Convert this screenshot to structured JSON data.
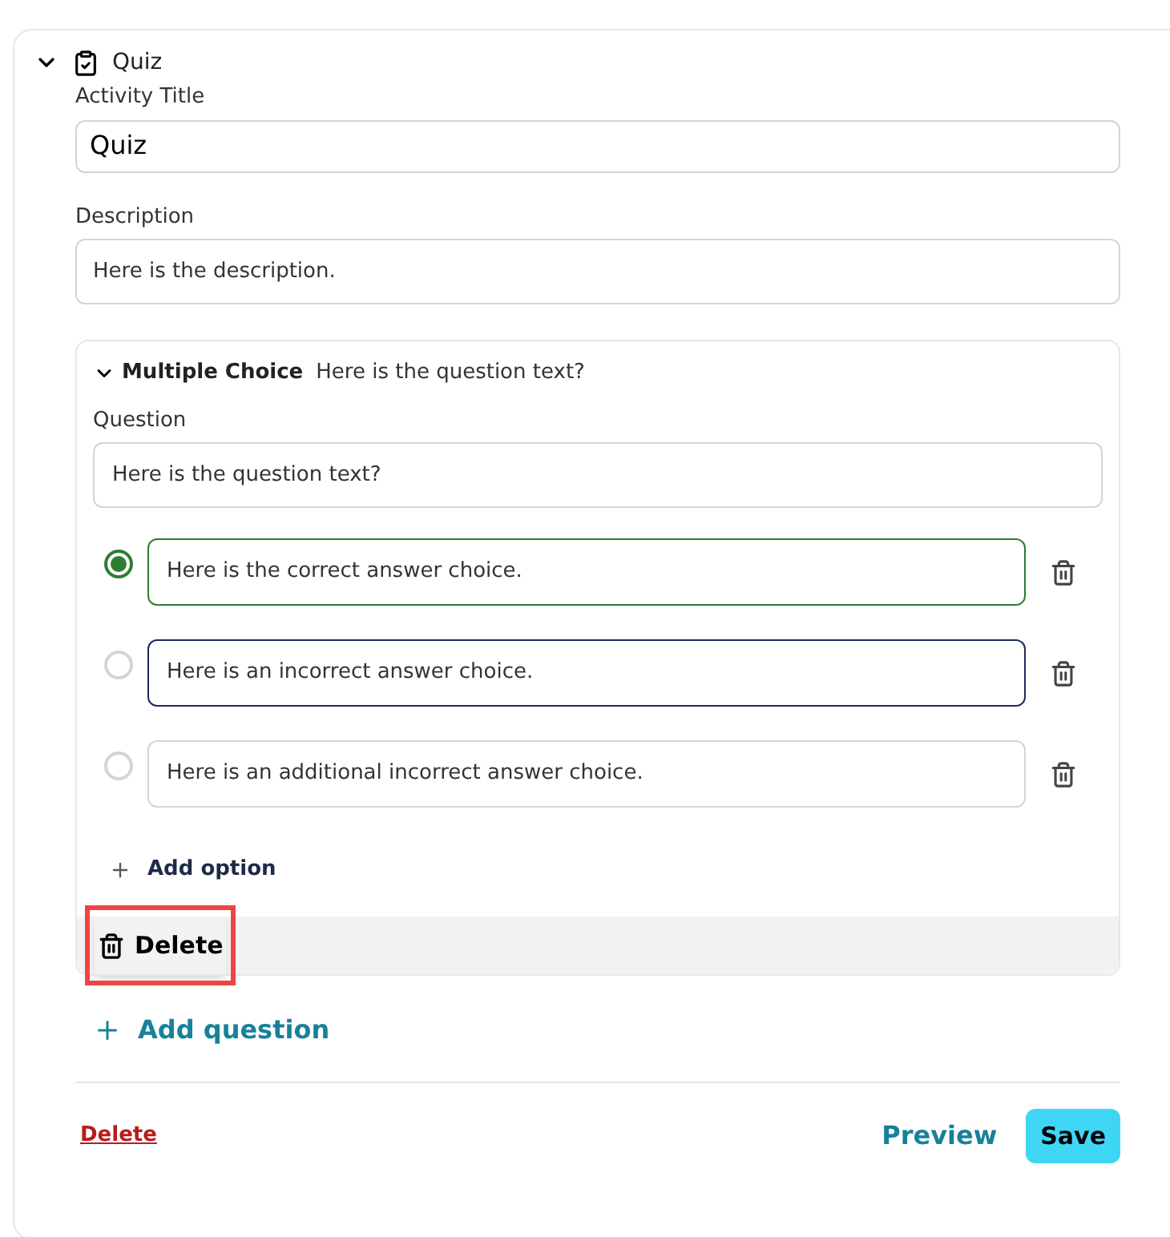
{
  "activity": {
    "title": "Quiz",
    "expanded": true
  },
  "fields": [
    {
      "label": "Activity Title",
      "value": "Quiz"
    },
    {
      "label": "Description",
      "value": "Here is the description."
    }
  ],
  "question": {
    "type_label": "Multiple Choice",
    "summary": "Here is the question text?",
    "expanded": true,
    "question_label": "Question",
    "question_value": "Here is the question text?",
    "choices": [
      {
        "text": "Here is the correct answer choice.",
        "selected": true,
        "focused": false
      },
      {
        "text": "Here is an incorrect answer choice.",
        "selected": false,
        "focused": true
      },
      {
        "text": "Here is an additional incorrect answer choice.",
        "selected": false,
        "focused": false
      }
    ],
    "add_option": "Add option",
    "delete": "Delete",
    "delete_highlighted": true
  },
  "add_question": "Add question",
  "footer": {
    "delete": "Delete",
    "preview": "Preview",
    "save": "Save"
  }
}
